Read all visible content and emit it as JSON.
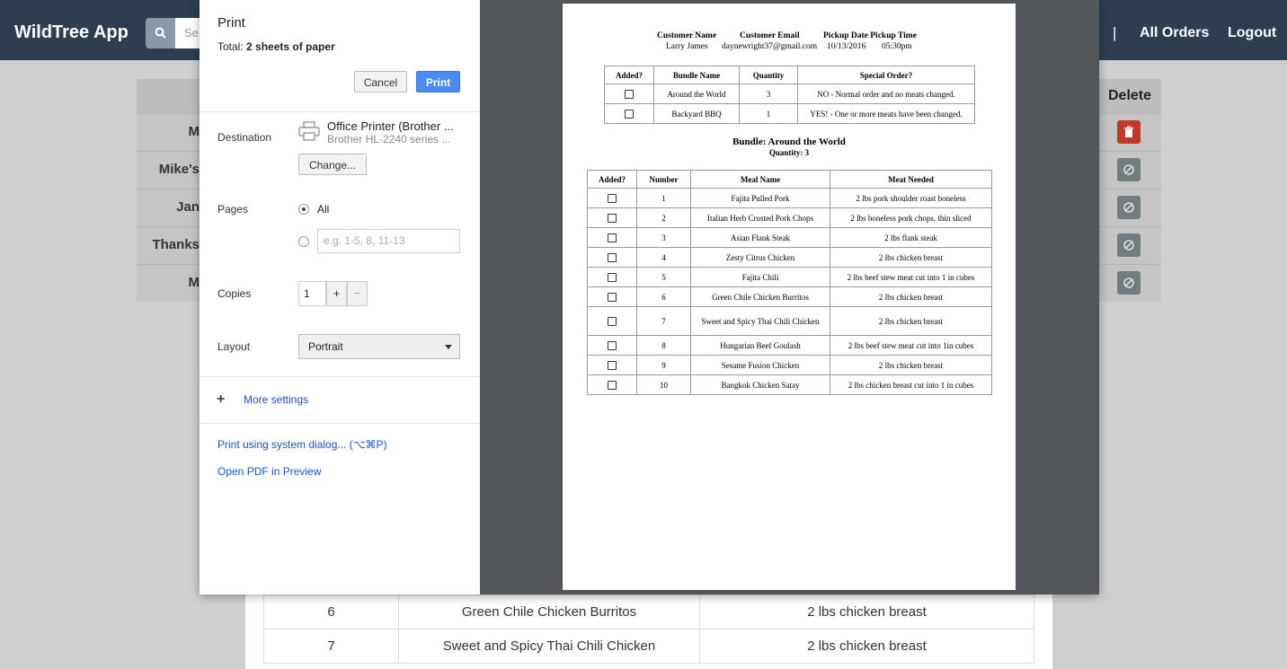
{
  "app": {
    "brand": "WildTree App",
    "search_placeholder": "Se",
    "nav_separator": "|",
    "nav_all_orders": "All Orders",
    "nav_logout": "Logout",
    "delete_header": "Delete",
    "row_names": [
      "M",
      "Mike's",
      "Jan",
      "Thanks",
      "M"
    ]
  },
  "background_table": {
    "rows": [
      {
        "number": "6",
        "meal": "Green Chile Chicken Burritos",
        "meat": "2 lbs chicken breast"
      },
      {
        "number": "7",
        "meal": "Sweet and Spicy Thai Chili Chicken",
        "meat": "2 lbs chicken breast"
      }
    ]
  },
  "print_dialog": {
    "title": "Print",
    "total_label": "Total:",
    "total_value": "2 sheets of paper",
    "cancel": "Cancel",
    "print": "Print",
    "destination_label": "Destination",
    "destination_name": "Office Printer (Brother ...",
    "destination_sub": "Brother HL-2240 series ...",
    "change": "Change...",
    "pages_label": "Pages",
    "pages_all": "All",
    "pages_placeholder": "e.g. 1-5, 8, 11-13",
    "copies_label": "Copies",
    "copies_value": "1",
    "copies_plus": "+",
    "copies_minus": "−",
    "layout_label": "Layout",
    "layout_value": "Portrait",
    "more_settings": "More settings",
    "system_dialog": "Print using system dialog... (⌥⌘P)",
    "open_pdf": "Open PDF in Preview"
  },
  "document": {
    "customer_name_h": "Customer Name",
    "customer_email_h": "Customer Email",
    "pickup_h": "Pickup Date Pickup Time",
    "customer_name": "Larry James",
    "customer_email": "daynewright37@gmail.com",
    "pickup_date": "10/13/2016",
    "pickup_time": "05:30pm",
    "bundles_headers": [
      "Added?",
      "Bundle Name",
      "Quantity",
      "Special Order?"
    ],
    "bundles": [
      {
        "name": "Around the World",
        "qty": "3",
        "special": "NO - Normal order and no meats changed."
      },
      {
        "name": "Backyard BBQ",
        "qty": "1",
        "special": "YES! - One or more meats have been changed."
      }
    ],
    "bundle_title": "Bundle: Around the World",
    "bundle_qty": "Quantity: 3",
    "meals_headers": [
      "Added?",
      "Number",
      "Meal Name",
      "Meat Needed"
    ],
    "meals": [
      {
        "num": "1",
        "name": "Fajita Pulled Pork",
        "meat": "2 lbs pork shoulder roast boneless"
      },
      {
        "num": "2",
        "name": "Italian Herb Crusted Pork Chops",
        "meat": "2 lbs boneless pork chops, thin sliced"
      },
      {
        "num": "3",
        "name": "Asian Flank Steak",
        "meat": "2 lbs flank steak"
      },
      {
        "num": "4",
        "name": "Zesty Citrus Chicken",
        "meat": "2 lbs chicken breast"
      },
      {
        "num": "5",
        "name": "Fajita Chili",
        "meat": "2 lbs beef stew meat cut into 1 in cubes"
      },
      {
        "num": "6",
        "name": "Green Chile Chicken Burritos",
        "meat": "2 lbs chicken breast"
      },
      {
        "num": "7",
        "name": "Sweet and Spicy Thai Chili Chicken",
        "meat": "2 lbs chicken breast"
      },
      {
        "num": "8",
        "name": "Hungarian Beef Goulash",
        "meat": "2 lbs beef stew meat cut into 1in cubes"
      },
      {
        "num": "9",
        "name": "Sesame Fusion Chicken",
        "meat": "2 lbs chicken breast"
      },
      {
        "num": "10",
        "name": "Bangkok Chicken Satay",
        "meat": "2 lbs chicken breast cut into 1 in cubes"
      }
    ]
  },
  "colors": {
    "navbar": "#2c3e50",
    "print_button": "#4a8af4",
    "link": "#1a54c4",
    "delete_red": "#c0392b"
  }
}
